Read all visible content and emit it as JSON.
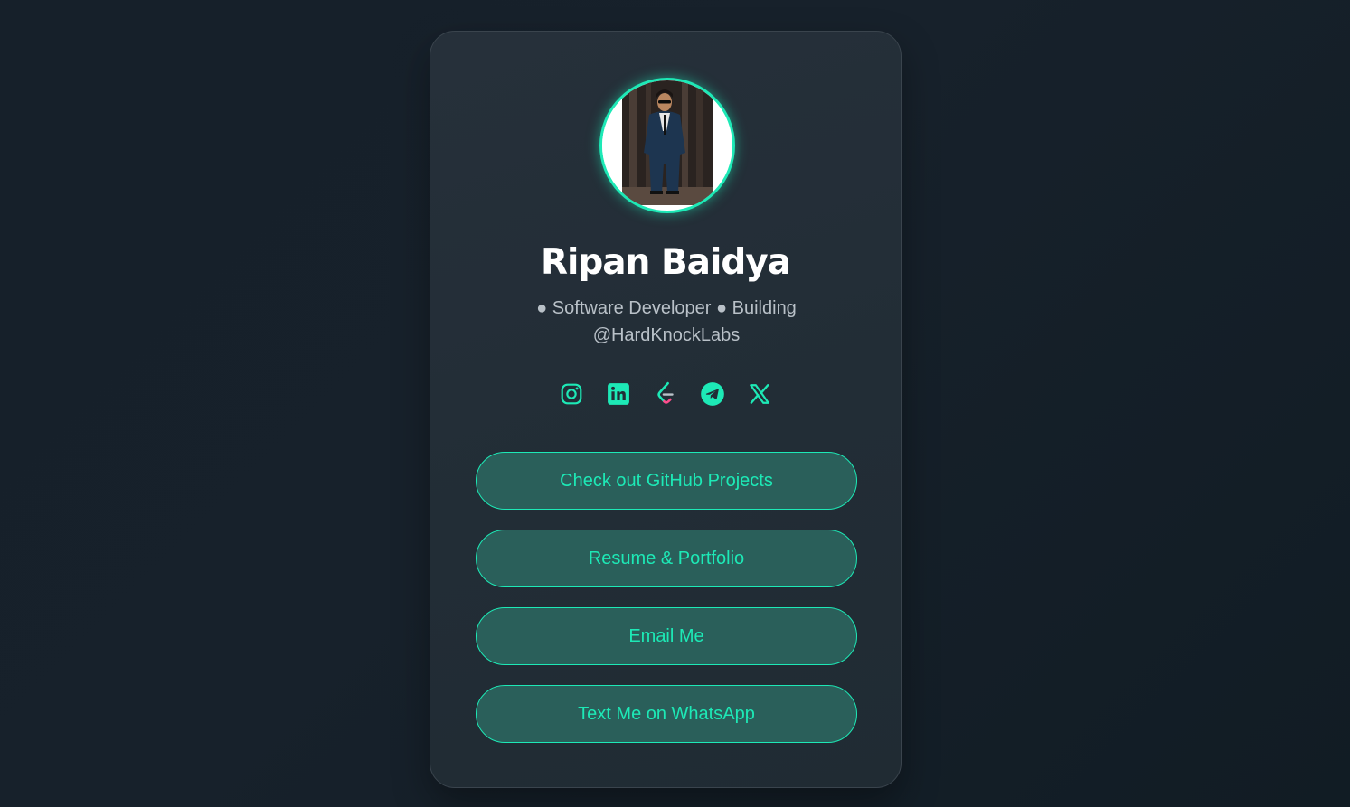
{
  "profile": {
    "name": "Ripan Baidya",
    "bio": "● Software Developer ● Building @HardKnockLabs",
    "avatar_alt": "profile photo"
  },
  "socials": [
    {
      "name": "instagram",
      "icon": "instagram-icon"
    },
    {
      "name": "linkedin",
      "icon": "linkedin-icon"
    },
    {
      "name": "leetcode",
      "icon": "leetcode-icon"
    },
    {
      "name": "telegram",
      "icon": "telegram-icon"
    },
    {
      "name": "x",
      "icon": "x-icon"
    }
  ],
  "links": {
    "github": "Check out GitHub Projects",
    "resume": "Resume & Portfolio",
    "email": "Email Me",
    "whatsapp": "Text Me on WhatsApp"
  },
  "colors": {
    "accent": "#1de9b6",
    "background": "#17212b",
    "card": "#242f38",
    "button_fill": "#2a5f5a",
    "bio_text": "#b9c1c8"
  }
}
